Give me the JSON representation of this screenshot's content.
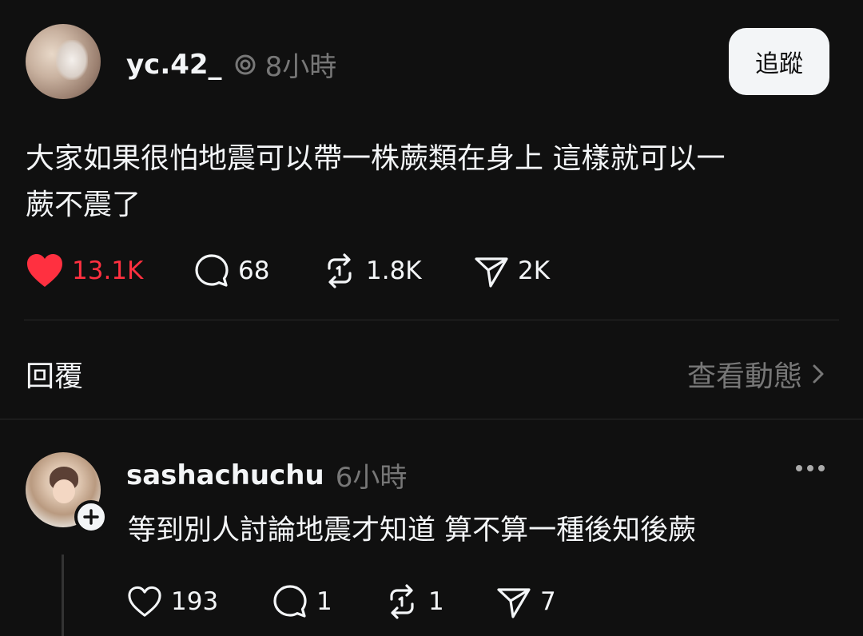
{
  "post": {
    "username": "yc.42_",
    "time": "8小時",
    "follow_label": "追蹤",
    "text_line1": "大家如果很怕地震可以帶一株蕨類在身上 這樣就可以一",
    "text_line2": "蕨不震了",
    "likes": "13.1K",
    "comments": "68",
    "reposts": "1.8K",
    "shares": "2K"
  },
  "replies_section": {
    "title": "回覆",
    "view_activity": "查看動態"
  },
  "reply": {
    "username": "sashachuchu",
    "time": "6小時",
    "text": "等到別人討論地震才知道 算不算一種後知後蕨",
    "likes": "193",
    "comments": "1",
    "reposts": "1",
    "shares": "7"
  },
  "colors": {
    "background": "#101010",
    "like_active": "#ff3040",
    "muted": "#777777",
    "text": "#f3f5f7"
  }
}
